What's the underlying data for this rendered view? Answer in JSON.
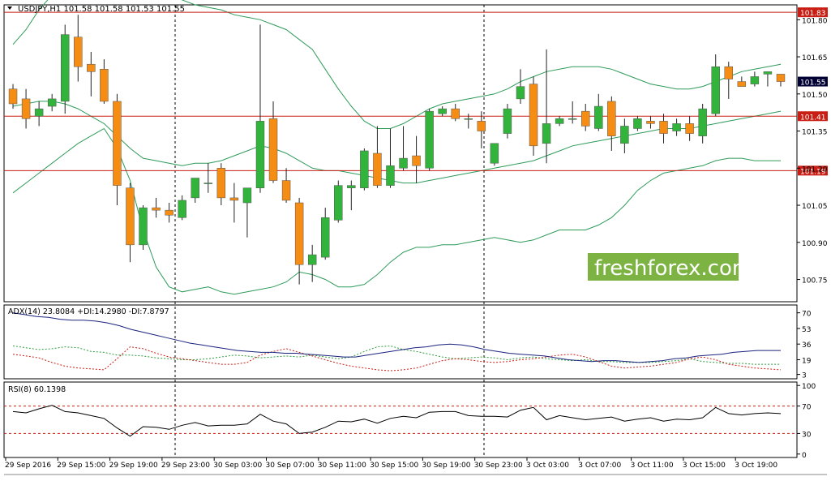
{
  "chart_data": {
    "type": "candlestick",
    "symbol_header": "USDJPY,H1  101.58 101.58 101.53 101.55",
    "watermark": "freshforex.com",
    "colors": {
      "bull": "#32b43c",
      "bear": "#f58c14",
      "wick": "#222222",
      "bollinger": "#2e9b5a",
      "level_line": "#c81e14",
      "adx": "#1a237e",
      "plus_di": "#2e9b3c",
      "minus_di": "#c81e14",
      "rsi": "#000000",
      "rsi_levels": "#c81e14",
      "watermark_bg": "#7cb342"
    },
    "price_axis": {
      "ylim": [
        100.66,
        101.86
      ],
      "ticks": [
        "101.80",
        "101.65",
        "101.50",
        "101.35",
        "101.20",
        "101.05",
        "100.90",
        "100.75"
      ],
      "tick_values": [
        101.8,
        101.65,
        101.5,
        101.35,
        101.2,
        101.05,
        100.9,
        100.75
      ]
    },
    "levels": [
      {
        "value": 101.83,
        "label": "101.83",
        "color": "#c81e14"
      },
      {
        "value": 101.41,
        "label": "101.41",
        "color": "#c81e14"
      },
      {
        "value": 101.19,
        "label": "101.19",
        "color": "#c81e14"
      }
    ],
    "current_price": {
      "value": 101.55,
      "label": "101.55"
    },
    "time_labels": [
      "29 Sep 2016",
      "29 Sep 15:00",
      "29 Sep 19:00",
      "29 Sep 23:00",
      "30 Sep 03:00",
      "30 Sep 07:00",
      "30 Sep 11:00",
      "30 Sep 15:00",
      "30 Sep 19:00",
      "30 Sep 23:00",
      "3 Oct 03:00",
      "3 Oct 07:00",
      "3 Oct 11:00",
      "3 Oct 15:00",
      "3 Oct 19:00"
    ],
    "candles": [
      {
        "o": 101.52,
        "h": 101.54,
        "l": 101.44,
        "c": 101.46
      },
      {
        "o": 101.48,
        "h": 101.52,
        "l": 101.36,
        "c": 101.4
      },
      {
        "o": 101.41,
        "h": 101.47,
        "l": 101.37,
        "c": 101.44
      },
      {
        "o": 101.45,
        "h": 101.5,
        "l": 101.43,
        "c": 101.48
      },
      {
        "o": 101.47,
        "h": 101.78,
        "l": 101.42,
        "c": 101.74
      },
      {
        "o": 101.73,
        "h": 101.82,
        "l": 101.55,
        "c": 101.61
      },
      {
        "o": 101.62,
        "h": 101.67,
        "l": 101.49,
        "c": 101.59
      },
      {
        "o": 101.6,
        "h": 101.64,
        "l": 101.46,
        "c": 101.47
      },
      {
        "o": 101.47,
        "h": 101.5,
        "l": 101.05,
        "c": 101.13
      },
      {
        "o": 101.12,
        "h": 101.14,
        "l": 100.82,
        "c": 100.89
      },
      {
        "o": 100.89,
        "h": 101.05,
        "l": 100.87,
        "c": 101.04
      },
      {
        "o": 101.04,
        "h": 101.08,
        "l": 101.0,
        "c": 101.03
      },
      {
        "o": 101.03,
        "h": 101.06,
        "l": 100.98,
        "c": 101.01
      },
      {
        "o": 101.0,
        "h": 101.09,
        "l": 100.99,
        "c": 101.07
      },
      {
        "o": 101.08,
        "h": 101.13,
        "l": 101.06,
        "c": 101.16
      },
      {
        "o": 101.14,
        "h": 101.22,
        "l": 101.1,
        "c": 101.14
      },
      {
        "o": 101.2,
        "h": 101.22,
        "l": 101.05,
        "c": 101.08
      },
      {
        "o": 101.08,
        "h": 101.14,
        "l": 100.98,
        "c": 101.07
      },
      {
        "o": 101.06,
        "h": 101.11,
        "l": 100.92,
        "c": 101.12
      },
      {
        "o": 101.12,
        "h": 101.78,
        "l": 101.1,
        "c": 101.39
      },
      {
        "o": 101.4,
        "h": 101.47,
        "l": 101.14,
        "c": 101.15
      },
      {
        "o": 101.15,
        "h": 101.2,
        "l": 101.06,
        "c": 101.07
      },
      {
        "o": 101.06,
        "h": 101.08,
        "l": 100.73,
        "c": 100.81
      },
      {
        "o": 100.81,
        "h": 100.89,
        "l": 100.74,
        "c": 100.85
      },
      {
        "o": 100.84,
        "h": 101.04,
        "l": 100.83,
        "c": 101.0
      },
      {
        "o": 100.99,
        "h": 101.15,
        "l": 100.98,
        "c": 101.13
      },
      {
        "o": 101.12,
        "h": 101.15,
        "l": 101.03,
        "c": 101.13
      },
      {
        "o": 101.12,
        "h": 101.28,
        "l": 101.11,
        "c": 101.27
      },
      {
        "o": 101.26,
        "h": 101.37,
        "l": 101.12,
        "c": 101.13
      },
      {
        "o": 101.13,
        "h": 101.36,
        "l": 101.12,
        "c": 101.21
      },
      {
        "o": 101.2,
        "h": 101.37,
        "l": 101.19,
        "c": 101.24
      },
      {
        "o": 101.25,
        "h": 101.33,
        "l": 101.14,
        "c": 101.21
      },
      {
        "o": 101.2,
        "h": 101.44,
        "l": 101.19,
        "c": 101.43
      },
      {
        "o": 101.42,
        "h": 101.45,
        "l": 101.41,
        "c": 101.44
      },
      {
        "o": 101.44,
        "h": 101.46,
        "l": 101.39,
        "c": 101.4
      },
      {
        "o": 101.4,
        "h": 101.42,
        "l": 101.36,
        "c": 101.4
      },
      {
        "o": 101.39,
        "h": 101.43,
        "l": 101.28,
        "c": 101.35
      },
      {
        "o": 101.22,
        "h": 101.3,
        "l": 101.21,
        "c": 101.3
      },
      {
        "o": 101.34,
        "h": 101.46,
        "l": 101.32,
        "c": 101.44
      },
      {
        "o": 101.48,
        "h": 101.6,
        "l": 101.46,
        "c": 101.53
      },
      {
        "o": 101.54,
        "h": 101.57,
        "l": 101.25,
        "c": 101.29
      },
      {
        "o": 101.3,
        "h": 101.68,
        "l": 101.22,
        "c": 101.38
      },
      {
        "o": 101.38,
        "h": 101.41,
        "l": 101.37,
        "c": 101.4
      },
      {
        "o": 101.4,
        "h": 101.47,
        "l": 101.38,
        "c": 101.4
      },
      {
        "o": 101.43,
        "h": 101.46,
        "l": 101.35,
        "c": 101.37
      },
      {
        "o": 101.36,
        "h": 101.5,
        "l": 101.35,
        "c": 101.45
      },
      {
        "o": 101.47,
        "h": 101.49,
        "l": 101.27,
        "c": 101.33
      },
      {
        "o": 101.3,
        "h": 101.4,
        "l": 101.26,
        "c": 101.37
      },
      {
        "o": 101.36,
        "h": 101.41,
        "l": 101.35,
        "c": 101.4
      },
      {
        "o": 101.39,
        "h": 101.41,
        "l": 101.36,
        "c": 101.38
      },
      {
        "o": 101.39,
        "h": 101.42,
        "l": 101.3,
        "c": 101.34
      },
      {
        "o": 101.35,
        "h": 101.4,
        "l": 101.33,
        "c": 101.38
      },
      {
        "o": 101.38,
        "h": 101.41,
        "l": 101.31,
        "c": 101.34
      },
      {
        "o": 101.33,
        "h": 101.46,
        "l": 101.3,
        "c": 101.44
      },
      {
        "o": 101.42,
        "h": 101.66,
        "l": 101.41,
        "c": 101.61
      },
      {
        "o": 101.61,
        "h": 101.63,
        "l": 101.48,
        "c": 101.56
      },
      {
        "o": 101.55,
        "h": 101.57,
        "l": 101.53,
        "c": 101.53
      },
      {
        "o": 101.54,
        "h": 101.59,
        "l": 101.53,
        "c": 101.57
      },
      {
        "o": 101.58,
        "h": 101.59,
        "l": 101.53,
        "c": 101.59
      },
      {
        "o": 101.58,
        "h": 101.58,
        "l": 101.53,
        "c": 101.55
      }
    ],
    "bollinger": {
      "upper": [
        101.7,
        101.76,
        101.84,
        101.9,
        101.95,
        101.96,
        101.98,
        101.98,
        101.97,
        101.96,
        101.94,
        101.92,
        101.9,
        101.88,
        101.86,
        101.85,
        101.84,
        101.82,
        101.81,
        101.8,
        101.78,
        101.76,
        101.72,
        101.68,
        101.6,
        101.52,
        101.45,
        101.39,
        101.36,
        101.36,
        101.38,
        101.41,
        101.44,
        101.46,
        101.47,
        101.48,
        101.49,
        101.5,
        101.52,
        101.55,
        101.57,
        101.59,
        101.6,
        101.61,
        101.61,
        101.61,
        101.6,
        101.58,
        101.56,
        101.54,
        101.53,
        101.52,
        101.52,
        101.53,
        101.55,
        101.57,
        101.59,
        101.6,
        101.61,
        101.62
      ],
      "middle": [
        101.45,
        101.46,
        101.47,
        101.47,
        101.46,
        101.44,
        101.41,
        101.38,
        101.33,
        101.28,
        101.24,
        101.23,
        101.22,
        101.21,
        101.22,
        101.22,
        101.23,
        101.25,
        101.27,
        101.29,
        101.28,
        101.26,
        101.23,
        101.2,
        101.19,
        101.19,
        101.18,
        101.17,
        101.16,
        101.15,
        101.14,
        101.14,
        101.15,
        101.16,
        101.17,
        101.18,
        101.19,
        101.2,
        101.21,
        101.22,
        101.23,
        101.25,
        101.27,
        101.29,
        101.3,
        101.31,
        101.32,
        101.33,
        101.34,
        101.35,
        101.36,
        101.36,
        101.36,
        101.37,
        101.38,
        101.39,
        101.4,
        101.41,
        101.42,
        101.43
      ],
      "lower": [
        101.1,
        101.14,
        101.18,
        101.22,
        101.26,
        101.3,
        101.33,
        101.36,
        101.28,
        101.15,
        100.95,
        100.8,
        100.72,
        100.7,
        100.71,
        100.72,
        100.7,
        100.69,
        100.7,
        100.71,
        100.72,
        100.74,
        100.78,
        100.77,
        100.75,
        100.72,
        100.72,
        100.73,
        100.77,
        100.82,
        100.86,
        100.88,
        100.88,
        100.89,
        100.89,
        100.9,
        100.91,
        100.92,
        100.91,
        100.9,
        100.91,
        100.93,
        100.95,
        100.95,
        100.95,
        100.97,
        101.0,
        101.05,
        101.11,
        101.15,
        101.18,
        101.19,
        101.2,
        101.21,
        101.23,
        101.24,
        101.24,
        101.23,
        101.23,
        101.23
      ]
    },
    "adx_panel": {
      "label": "ADX(14) 23.8084 +DI:14.2980 -DI:7.8797",
      "ylim": [
        0,
        75
      ],
      "ticks": [
        "70",
        "53",
        "36",
        "19",
        "3"
      ],
      "tick_values": [
        70,
        53,
        36,
        19,
        3
      ],
      "adx": [
        70,
        68,
        66,
        65,
        63,
        62,
        62,
        61,
        59,
        56,
        52,
        49,
        46,
        43,
        40,
        37,
        35,
        33,
        31,
        29,
        28,
        27,
        27,
        26,
        26,
        25,
        24,
        23,
        22,
        22,
        24,
        26,
        28,
        30,
        32,
        33,
        35,
        36,
        35,
        33,
        30,
        28,
        26,
        25,
        24,
        23,
        21,
        19,
        18,
        17,
        18,
        18,
        17,
        16,
        17,
        18,
        20,
        21,
        23,
        24,
        25,
        27,
        28,
        29,
        29,
        29
      ],
      "plus_di": [
        34,
        32,
        30,
        31,
        33,
        32,
        28,
        27,
        24,
        24,
        23,
        21,
        20,
        19,
        19,
        20,
        22,
        24,
        23,
        21,
        22,
        23,
        22,
        24,
        22,
        20,
        22,
        28,
        33,
        34,
        30,
        28,
        25,
        22,
        20,
        21,
        22,
        21,
        19,
        21,
        22,
        20,
        19,
        18,
        19,
        17,
        17,
        16,
        16,
        16,
        17,
        18,
        20,
        17,
        16,
        15,
        15,
        14,
        14,
        14
      ],
      "minus_di": [
        25,
        23,
        21,
        16,
        12,
        10,
        9,
        8,
        20,
        33,
        31,
        26,
        22,
        20,
        18,
        16,
        14,
        14,
        16,
        24,
        28,
        31,
        27,
        23,
        19,
        15,
        12,
        10,
        8,
        7,
        8,
        10,
        14,
        18,
        20,
        19,
        17,
        16,
        17,
        19,
        20,
        22,
        24,
        25,
        22,
        17,
        12,
        10,
        11,
        12,
        14,
        16,
        20,
        22,
        19,
        14,
        12,
        10,
        9,
        8
      ]
    },
    "rsi_panel": {
      "label": "RSI(8) 60.1398",
      "ylim": [
        -5,
        105
      ],
      "ticks": [
        "100",
        "70",
        "30",
        "0"
      ],
      "tick_values": [
        100,
        70,
        30,
        0
      ],
      "levels": [
        70,
        30
      ],
      "values": [
        62,
        60,
        66,
        71,
        62,
        60,
        56,
        52,
        38,
        26,
        40,
        39,
        36,
        42,
        46,
        41,
        42,
        42,
        44,
        58,
        48,
        44,
        30,
        32,
        39,
        48,
        47,
        51,
        45,
        52,
        55,
        53,
        61,
        62,
        62,
        56,
        55,
        55,
        54,
        64,
        68,
        50,
        56,
        53,
        50,
        52,
        54,
        48,
        51,
        53,
        48,
        51,
        50,
        53,
        68,
        59,
        57,
        59,
        60,
        59
      ]
    }
  }
}
